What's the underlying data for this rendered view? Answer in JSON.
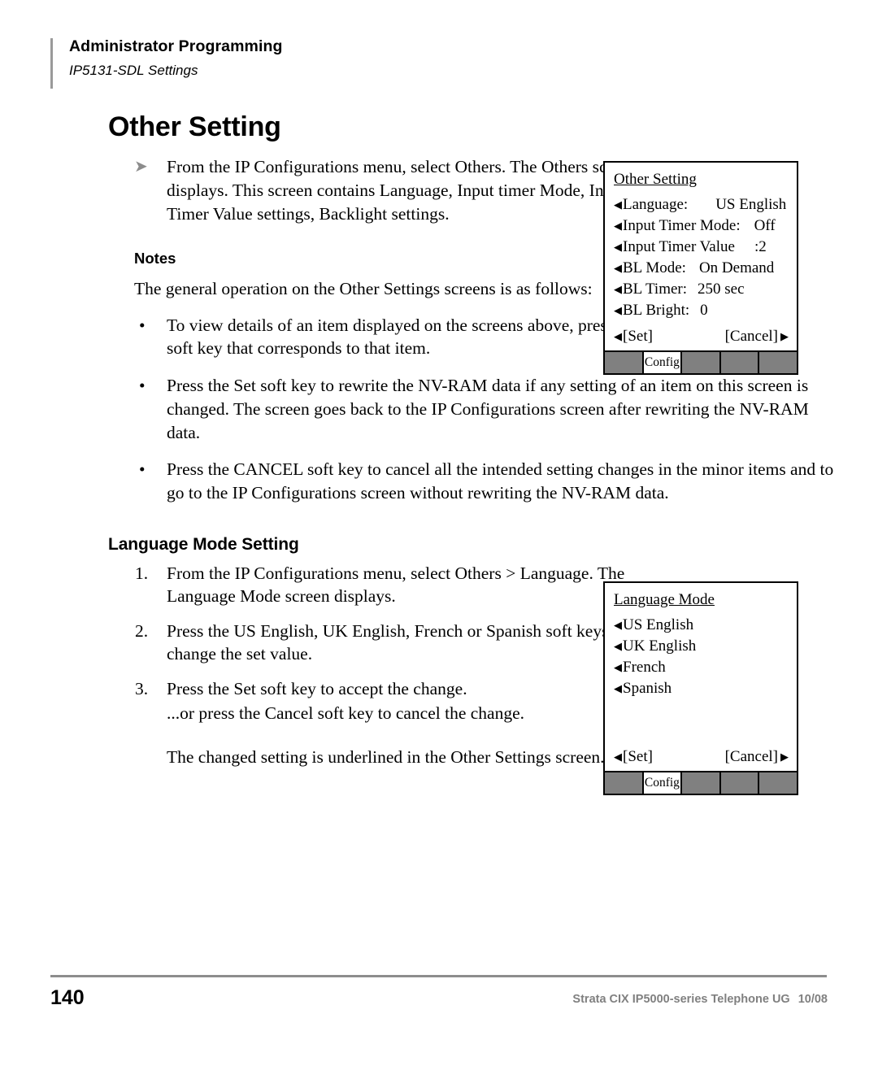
{
  "header": {
    "title": "Administrator Programming",
    "subtitle": "IP5131-SDL Settings"
  },
  "main": {
    "section_title": "Other Setting",
    "arrow_glyph": "➤",
    "intro_paragraph": "From the IP Configurations menu, select Others. The Others screen displays. This screen contains Language, Input timer Mode, Input Timer Value settings, Backlight settings.",
    "notes_label": "Notes",
    "notes_intro": "The general operation on the Other Settings screens is as follows:",
    "bullet_glyph": "•",
    "bullets": [
      "To view details of an item displayed on the screens above, press the soft key that corresponds to that item.",
      "Press the Set soft key to rewrite the NV-RAM data if any setting of an item on this screen is changed. The screen goes back to the IP Configurations screen after rewriting the NV-RAM data.",
      "Press the CANCEL soft key to cancel all the intended setting changes in the minor items and to go to the IP Configurations screen without rewriting the NV-RAM data."
    ],
    "subsection_title": "Language Mode Setting",
    "steps": [
      {
        "num": "1.",
        "text": "From the IP Configurations menu, select Others > Language. The Language Mode screen displays.",
        "subline": ""
      },
      {
        "num": "2.",
        "text": "Press the US English, UK English, French or Spanish soft keys to change the set value.",
        "subline": ""
      },
      {
        "num": "3.",
        "text": "Press the Set soft key to accept the change.",
        "subline": "...or press the Cancel soft key to cancel the change."
      }
    ],
    "closing_paragraph": "The changed setting is underlined in the Other Settings screen."
  },
  "lcd_other": {
    "title": "Other Setting",
    "tri_glyph": "◀",
    "rows": [
      {
        "label": "Language:",
        "value": "US English"
      },
      {
        "label": "Input Timer Mode:",
        "value": "Off"
      },
      {
        "label": "Input Timer Value",
        "value": ":2"
      },
      {
        "label": "BL Mode:",
        "value": "On Demand"
      },
      {
        "label": "BL Timer:",
        "value": "250 sec"
      },
      {
        "label": "BL Bright:",
        "value": "0"
      }
    ],
    "set_label": "[Set]",
    "cancel_label": "[Cancel]",
    "right_tri_glyph": "▶",
    "softkeys": [
      "",
      "Config",
      "",
      "",
      ""
    ],
    "active_softkey_index": 1
  },
  "lcd_language": {
    "title": "Language Mode",
    "tri_glyph": "◀",
    "rows": [
      {
        "label": "US English",
        "value": ""
      },
      {
        "label": "UK English",
        "value": ""
      },
      {
        "label": "French",
        "value": ""
      },
      {
        "label": "Spanish",
        "value": ""
      }
    ],
    "set_label": "[Set]",
    "cancel_label": "[Cancel]",
    "right_tri_glyph": "▶",
    "softkeys": [
      "",
      "Config",
      "",
      "",
      ""
    ],
    "active_softkey_index": 1
  },
  "footer": {
    "page_number": "140",
    "document": "Strata CIX IP5000-series Telephone UG",
    "date": "10/08"
  }
}
